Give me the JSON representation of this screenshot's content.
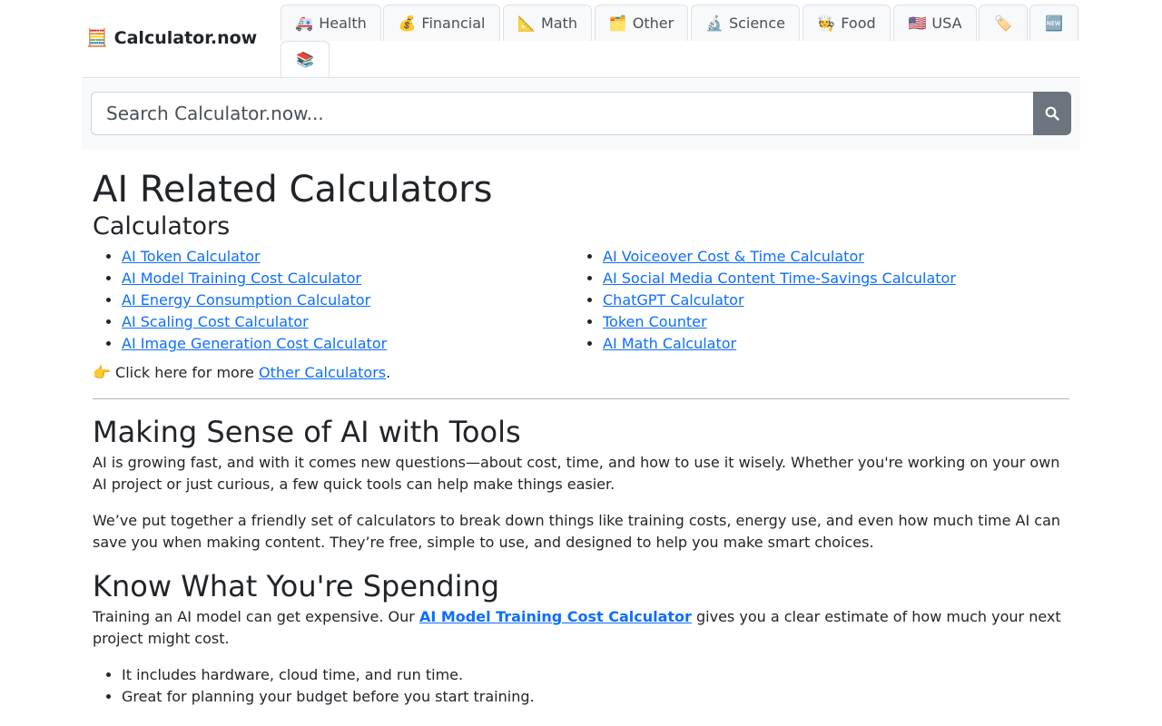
{
  "brand": {
    "emoji": "🧮",
    "name": "Calculator.now"
  },
  "tabs": [
    {
      "emoji": "🚑",
      "label": "Health"
    },
    {
      "emoji": "💰",
      "label": "Financial"
    },
    {
      "emoji": "📐",
      "label": "Math"
    },
    {
      "emoji": "🗂️",
      "label": "Other"
    },
    {
      "emoji": "🔬",
      "label": "Science"
    },
    {
      "emoji": "🧑‍🍳",
      "label": "Food"
    },
    {
      "emoji": "🇺🇸",
      "label": "USA"
    },
    {
      "emoji": "🏷️",
      "label": ""
    },
    {
      "emoji": "🆕",
      "label": ""
    },
    {
      "emoji": "📚",
      "label": ""
    }
  ],
  "search": {
    "placeholder": "Search Calculator.now...",
    "value": ""
  },
  "page_title": "AI Related Calculators",
  "calculators_heading": "Calculators",
  "calculators_left": [
    "AI Token Calculator",
    "AI Model Training Cost Calculator",
    "AI Energy Consumption Calculator",
    "AI Scaling Cost Calculator",
    "AI Image Generation Cost Calculator"
  ],
  "calculators_right": [
    "AI Voiceover Cost & Time Calculator",
    "AI Social Media Content Time-Savings Calculator",
    "ChatGPT Calculator",
    "Token Counter",
    "AI Math Calculator"
  ],
  "more": {
    "emoji": "👉",
    "prefix": "Click here for more",
    "link": "Other Calculators",
    "suffix": "."
  },
  "section1": {
    "heading": "Making Sense of AI with Tools",
    "para1": "AI is growing fast, and with it comes new questions—about cost, time, and how to use it wisely. Whether you're working on your own AI project or just curious, a few quick tools can help make things easier.",
    "para2": "We’ve put together a friendly set of calculators to break down things like training costs, energy use, and even how much time AI can save you when making content. They’re free, simple to use, and designed to help you make smart choices."
  },
  "section2": {
    "heading": "Know What You're Spending",
    "para_prefix": "Training an AI model can get expensive. Our",
    "para_link": "AI Model Training Cost Calculator",
    "para_suffix": "gives you a clear estimate of how much your next project might cost.",
    "bullets": [
      "It includes hardware, cloud time, and run time.",
      "Great for planning your budget before you start training."
    ]
  },
  "colors": {
    "link": "#0d6efd",
    "search_button": "#6c757d",
    "band": "#f8f9fa"
  },
  "icons": {
    "search_button": "search-icon"
  }
}
